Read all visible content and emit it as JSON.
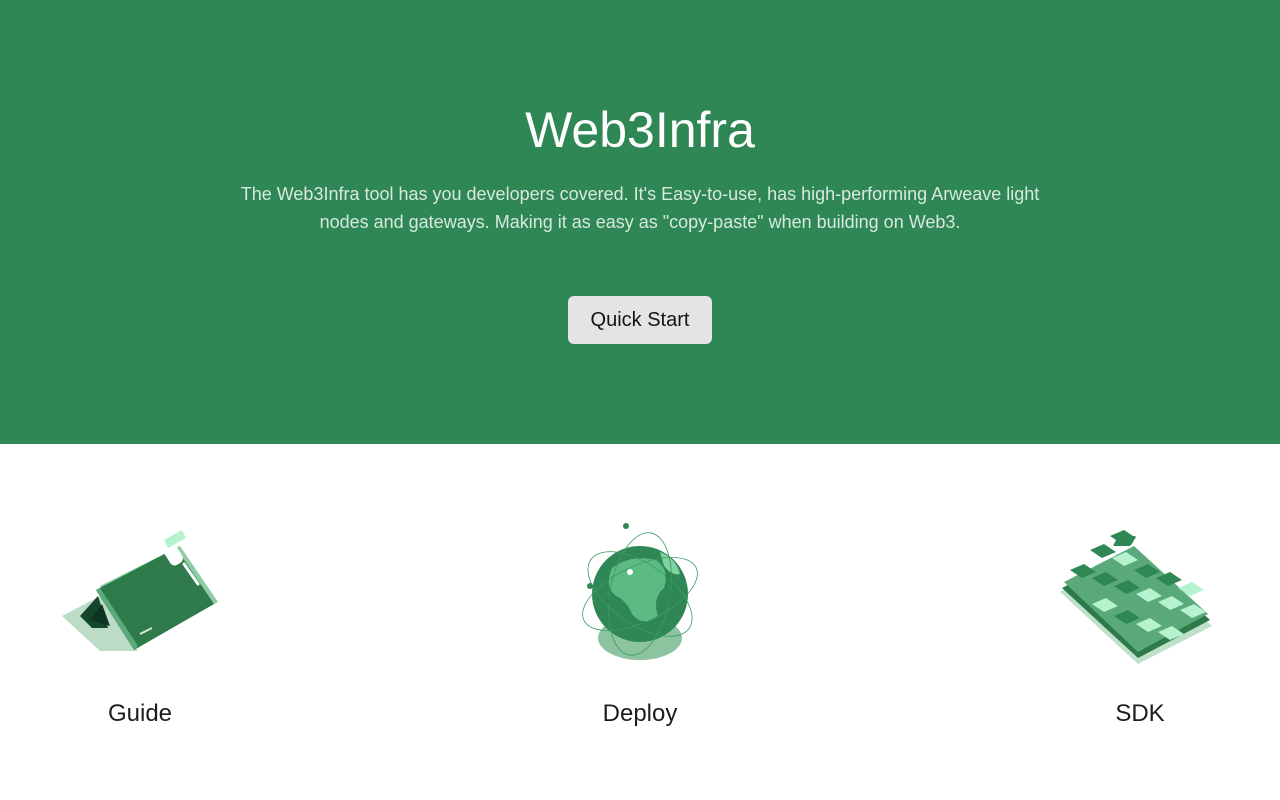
{
  "hero": {
    "title": "Web3Infra",
    "description": "The Web3Infra tool has you developers covered. It's Easy-to-use, has high-performing Arweave light nodes and gateways. Making it as easy as \"copy-paste\" when building on Web3.",
    "cta_label": "Quick Start"
  },
  "features": [
    {
      "label": "Guide",
      "icon": "guide-book-icon"
    },
    {
      "label": "Deploy",
      "icon": "globe-network-icon"
    },
    {
      "label": "SDK",
      "icon": "sdk-blocks-icon"
    }
  ],
  "colors": {
    "hero_bg": "#2f8755",
    "accent_light": "#b6f2cd",
    "accent_dark": "#2b7448",
    "button_bg": "#e4e4e4"
  }
}
